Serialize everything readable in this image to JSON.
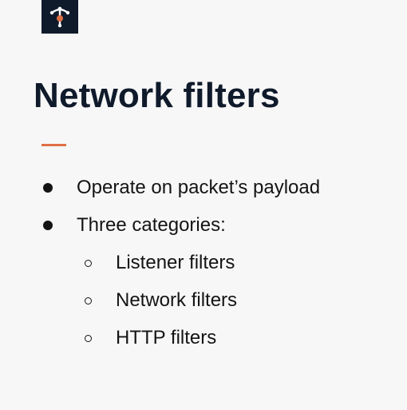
{
  "logo": {
    "icon": "envoy-logo-icon",
    "bg": "#0f1a2b",
    "accent": "#e07045"
  },
  "slide": {
    "title": "Network filters",
    "accent_color": "#e07045",
    "bullets": [
      {
        "text": "Operate on packet’s payload"
      },
      {
        "text": "Three categories:"
      }
    ],
    "sub_bullets": [
      {
        "text": "Listener filters"
      },
      {
        "text": "Network filters"
      },
      {
        "text": "HTTP filters"
      }
    ]
  }
}
